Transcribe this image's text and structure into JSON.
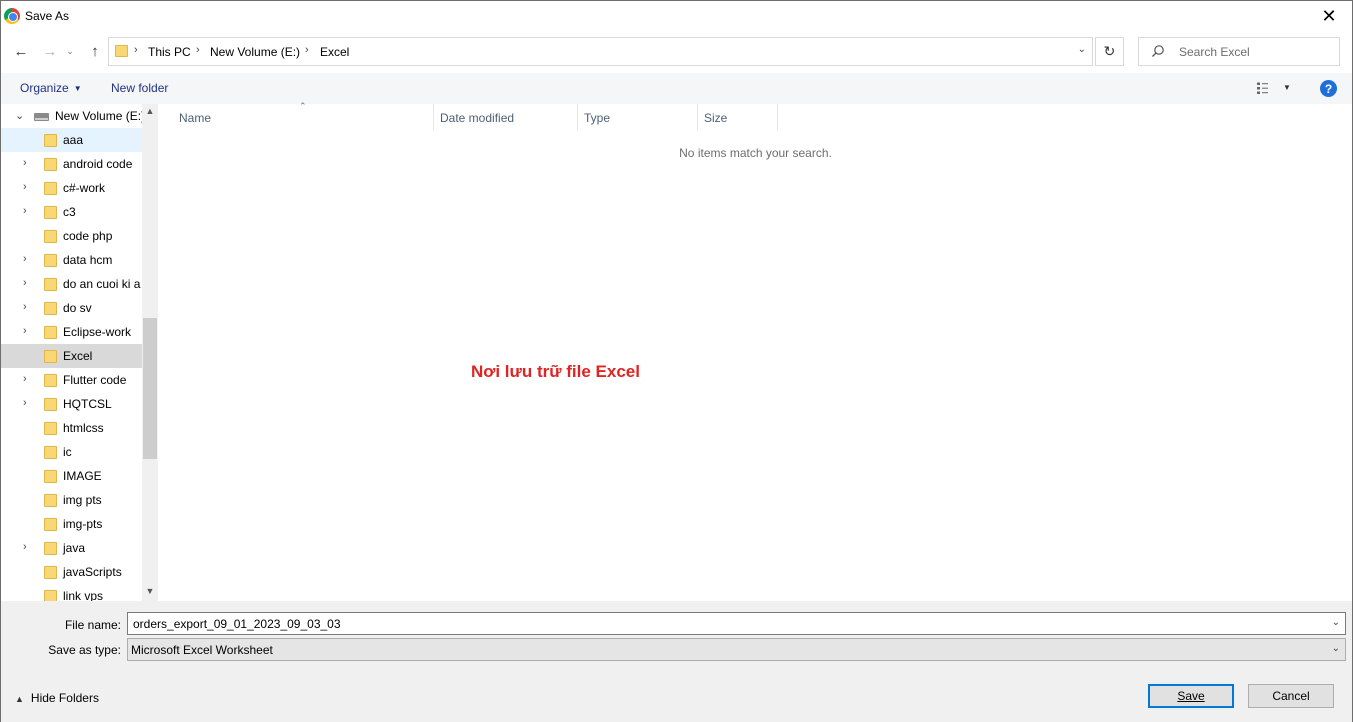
{
  "window": {
    "title": "Save As",
    "close_glyph": "✕"
  },
  "nav": {
    "back_glyph": "←",
    "forward_glyph": "→",
    "recent_glyph": "⌄",
    "up_glyph": "↑",
    "refresh_glyph": "↻"
  },
  "address": {
    "crumbs": [
      "This PC",
      "New Volume (E:)",
      "Excel"
    ],
    "separator": "›",
    "dropdown_glyph": "⌄"
  },
  "search": {
    "placeholder": "Search Excel"
  },
  "toolbar": {
    "organize_label": "Organize",
    "new_folder_label": "New folder",
    "help_label": "?"
  },
  "tree": {
    "drive_label": "New Volume (E:)",
    "items": [
      {
        "label": "aaa",
        "expandable": false,
        "state": "hover"
      },
      {
        "label": "android code",
        "expandable": true
      },
      {
        "label": "c#-work",
        "expandable": true
      },
      {
        "label": "c3",
        "expandable": true
      },
      {
        "label": "code php",
        "expandable": false
      },
      {
        "label": "data hcm",
        "expandable": true
      },
      {
        "label": "do an cuoi ki a",
        "expandable": true
      },
      {
        "label": "do sv",
        "expandable": true
      },
      {
        "label": "Eclipse-work",
        "expandable": true
      },
      {
        "label": "Excel",
        "expandable": false,
        "state": "selected"
      },
      {
        "label": "Flutter code",
        "expandable": true
      },
      {
        "label": "HQTCSL",
        "expandable": true
      },
      {
        "label": "htmlcss",
        "expandable": false
      },
      {
        "label": "ic",
        "expandable": false
      },
      {
        "label": "IMAGE",
        "expandable": false
      },
      {
        "label": "img pts",
        "expandable": false
      },
      {
        "label": "img-pts",
        "expandable": false
      },
      {
        "label": "java",
        "expandable": true
      },
      {
        "label": "javaScripts",
        "expandable": false
      },
      {
        "label": "link vps",
        "expandable": false
      }
    ]
  },
  "columns": [
    "Name",
    "Date modified",
    "Type",
    "Size"
  ],
  "filelist": {
    "empty_message": "No items match your search.",
    "annotation": "Nơi lưu trữ file Excel"
  },
  "form": {
    "filename_label": "File name:",
    "filename_value": "orders_export_09_01_2023_09_03_03",
    "savetype_label": "Save as type:",
    "savetype_value": "Microsoft Excel Worksheet"
  },
  "footer": {
    "hide_folders_label": "Hide Folders",
    "save_label": "Save",
    "cancel_label": "Cancel"
  },
  "colors": {
    "accent": "#0078d7",
    "annotation": "#e02424",
    "link": "#1e3287",
    "folder": "#f8d775"
  }
}
